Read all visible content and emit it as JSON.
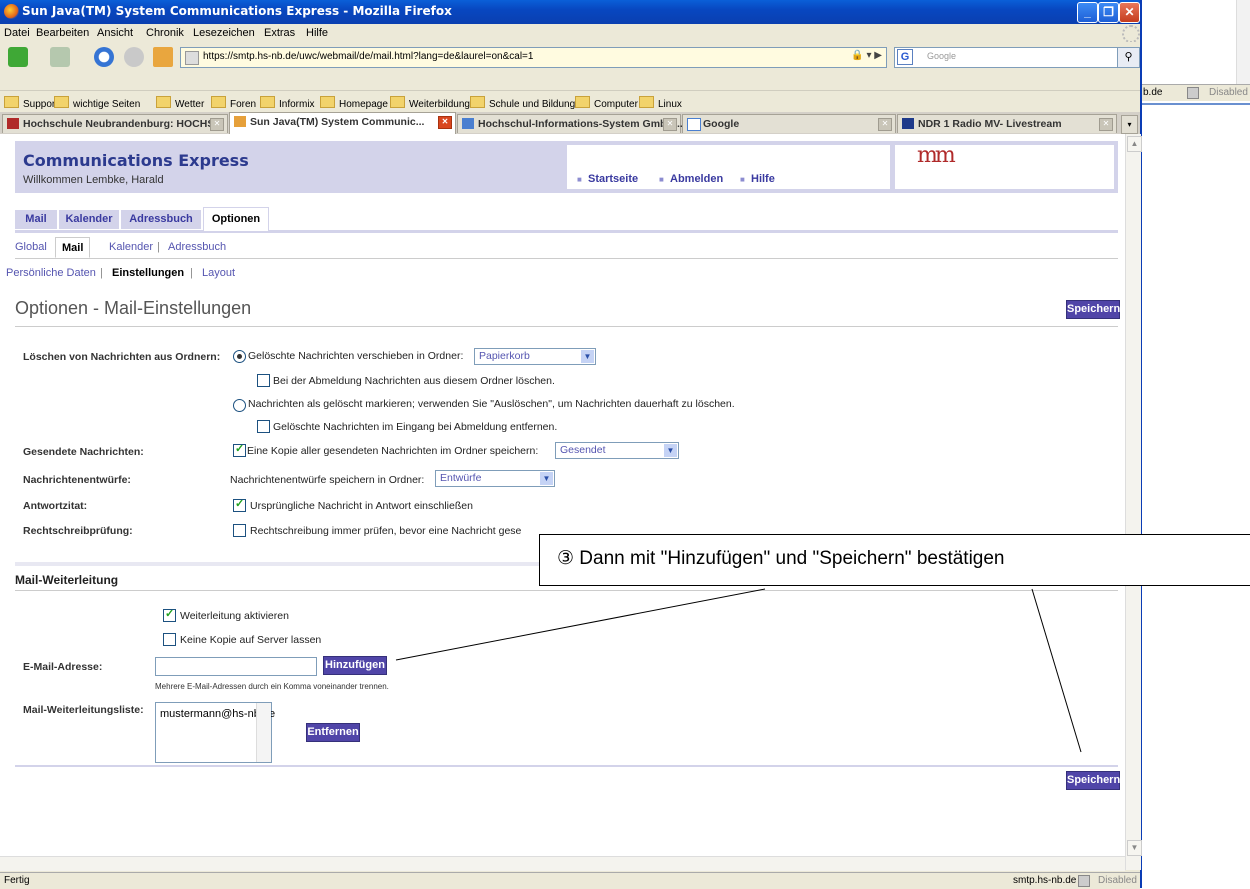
{
  "window": {
    "title": "Sun Java(TM) System Communications Express - Mozilla Firefox"
  },
  "menubar": [
    "Datei",
    "Bearbeiten",
    "Ansicht",
    "Chronik",
    "Lesezeichen",
    "Extras",
    "Hilfe"
  ],
  "navbar": {
    "url": "https://smtp.hs-nb.de/uwc/webmail/de/mail.html?lang=de&laurel=on&cal=1",
    "search_placeholder": "Google"
  },
  "bookmarks": [
    "Support",
    "wichtige Seiten",
    "Wetter",
    "Foren",
    "Informix",
    "Homepage",
    "Weiterbildung",
    "Schule und Bildung",
    "Computer",
    "Linux"
  ],
  "tabs": [
    {
      "label": "Hochschule Neubrandenburg: HOCHS...",
      "active": false
    },
    {
      "label": "Sun Java(TM) System Communic...",
      "active": true
    },
    {
      "label": "Hochschul-Informations-System GmbH...",
      "active": false
    },
    {
      "label": "Google",
      "active": false
    },
    {
      "label": "NDR 1 Radio MV- Livestream",
      "active": false
    }
  ],
  "background_window": {
    "domain_fragment": "b.de",
    "status": "Disabled"
  },
  "app": {
    "brand": "Communications Express",
    "welcome": "Willkommen Lembke, Harald",
    "links": [
      "Startseite",
      "Abmelden",
      "Hilfe"
    ],
    "logo": "mm"
  },
  "main_tabs": [
    "Mail",
    "Kalender",
    "Adressbuch",
    "Optionen"
  ],
  "sub_tabs": [
    "Global",
    "Mail",
    "Kalender",
    "Adressbuch"
  ],
  "sub_nav": [
    "Persönliche Daten",
    "Einstellungen",
    "Layout"
  ],
  "page_title": "Optionen - Mail-Einstellungen",
  "save_label": "Speichern",
  "settings": {
    "delete_label": "Löschen von Nachrichten aus Ordnern:",
    "delete_opt1": "Gelöschte Nachrichten verschieben in Ordner:",
    "delete_opt1_folder": "Papierkorb",
    "delete_opt1_sub": "Bei der Abmeldung Nachrichten aus diesem Ordner löschen.",
    "delete_opt2": "Nachrichten als gelöscht markieren; verwenden Sie \"Auslöschen\", um Nachrichten dauerhaft zu löschen.",
    "delete_opt2_sub": "Gelöschte Nachrichten im Eingang bei Abmeldung entfernen.",
    "sent_label": "Gesendete Nachrichten:",
    "sent_opt": "Eine Kopie aller gesendeten Nachrichten im Ordner speichern:",
    "sent_folder": "Gesendet",
    "drafts_label": "Nachrichtenentwürfe:",
    "drafts_opt": "Nachrichtenentwürfe speichern in Ordner:",
    "drafts_folder": "Entwürfe",
    "reply_label": "Antwortzitat:",
    "reply_opt": "Ursprüngliche Nachricht in Antwort einschließen",
    "spell_label": "Rechtschreibprüfung:",
    "spell_opt": "Rechtschreibung immer prüfen, bevor eine Nachricht gese"
  },
  "forwarding": {
    "heading": "Mail-Weiterleitung",
    "enable": "Weiterleitung aktivieren",
    "nocopy": "Keine Kopie auf Server lassen",
    "email_label": "E-Mail-Adresse:",
    "add_label": "Hinzufügen",
    "hint": "Mehrere E-Mail-Adressen durch ein Komma voneinander trennen.",
    "list_label": "Mail-Weiterleitungsliste:",
    "list_items": [
      "mustermann@hs-nb.de"
    ],
    "remove_label": "Entfernen"
  },
  "callout": "③ Dann mit \"Hinzufügen\" und \"Speichern\" bestätigen",
  "status": {
    "left": "Fertig",
    "host": "smtp.hs-nb.de",
    "right": "Disabled"
  }
}
